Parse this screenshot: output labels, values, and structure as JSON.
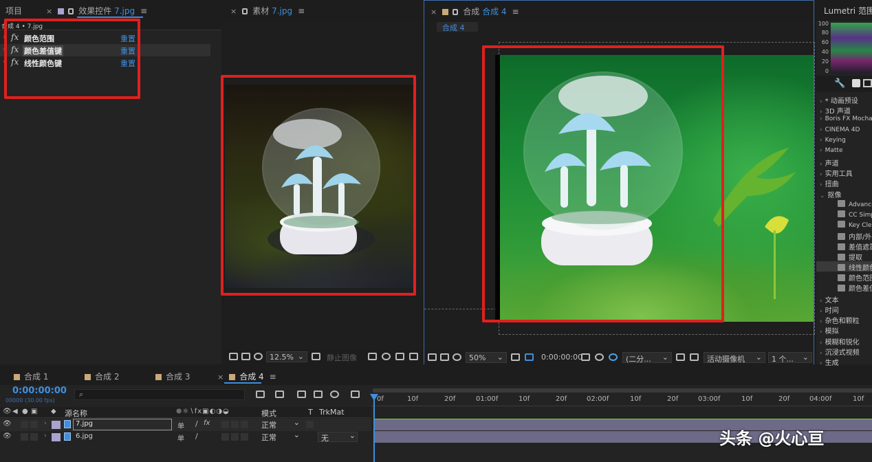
{
  "project_panel": {
    "tab_project": "项目",
    "tab_effect_controls": "效果控件",
    "effect_controls_file": "7.jpg",
    "breadcrumb": "合成 4 • 7.jpg",
    "effects": [
      {
        "fx": "fx",
        "name": "颜色范围",
        "reset": "重置"
      },
      {
        "fx": "fx",
        "name": "颜色差值键",
        "reset": "重置"
      },
      {
        "fx": "fx",
        "name": "线性颜色键",
        "reset": "重置"
      }
    ]
  },
  "footage_panel": {
    "title": "素材",
    "file": "7.jpg",
    "zoom": "12.5%",
    "still_label": "静止图像"
  },
  "comp_panel": {
    "title": "合成",
    "comp_name": "合成 4",
    "breadcrumb": "合成 4",
    "zoom": "50%",
    "timecode": "0:00:00:00",
    "resolution": "(二分...",
    "camera": "活动摄像机",
    "views": "1 个..."
  },
  "right_panel": {
    "title": "Lumetri 范围",
    "scope_ticks": [
      "100",
      "80",
      "60",
      "40",
      "20",
      "0"
    ],
    "categories": [
      {
        "label": "* 动画预设"
      },
      {
        "label": "3D 声道"
      },
      {
        "label": "Boris FX Mocha"
      },
      {
        "label": "CINEMA 4D"
      },
      {
        "label": "Keying"
      },
      {
        "label": "Matte"
      },
      {
        "label": "声道"
      },
      {
        "label": "实用工具"
      },
      {
        "label": "扭曲"
      },
      {
        "label": "抠像"
      }
    ],
    "keying_items": [
      "Advanced",
      "CC Simple",
      "Key Clea",
      "内部/外",
      "差值遮罩",
      "提取",
      "线性颜色",
      "颜色范围",
      "颜色差值"
    ],
    "more_categories": [
      "文本",
      "时间",
      "杂色和颗粒",
      "模拟",
      "模糊和锐化",
      "沉浸式视频",
      "生成"
    ]
  },
  "timeline": {
    "tabs": [
      {
        "name": "合成 1",
        "color": "#c9a97a"
      },
      {
        "name": "合成 2",
        "color": "#c9a97a"
      },
      {
        "name": "合成 3",
        "color": "#c9a97a"
      },
      {
        "name": "合成 4",
        "color": "#c9a97a"
      }
    ],
    "timecode": "0:00:00:00",
    "fps": "00000 (30.00 fps)",
    "columns": {
      "source_name": "源名称",
      "mode": "模式",
      "t": "T",
      "trkmat": "TrkMat"
    },
    "layers": [
      {
        "name": "7.jpg",
        "mode": "正常",
        "trkmat": ""
      },
      {
        "name": "6.jpg",
        "mode": "正常",
        "trkmat": "无"
      }
    ],
    "ruler": [
      "0f",
      "10f",
      "20f",
      "01:00f",
      "10f",
      "20f",
      "02:00f",
      "10f",
      "20f",
      "03:00f",
      "10f",
      "20f",
      "04:00f",
      "10f"
    ]
  },
  "watermark": "头条 @火心亘",
  "colors": {
    "accent": "#3f8fe0",
    "highlight": "#e0201e",
    "label_lavender": "#a8a3cf"
  }
}
